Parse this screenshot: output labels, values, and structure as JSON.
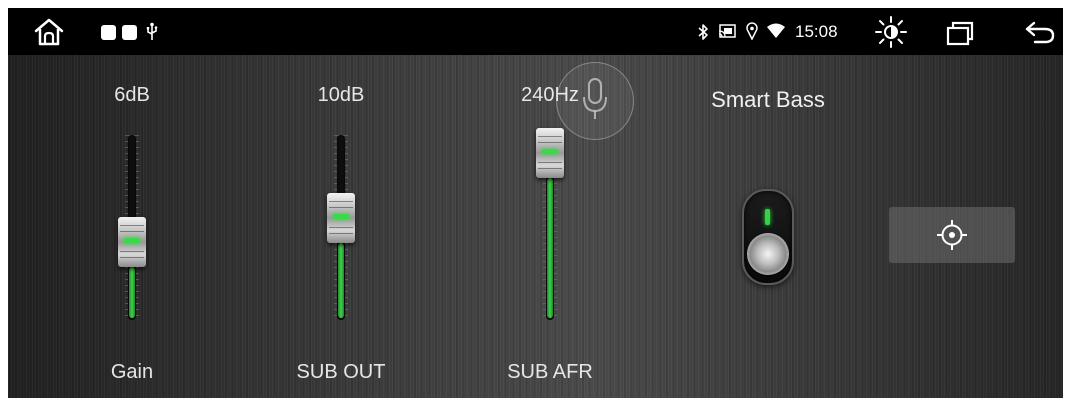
{
  "status_bar": {
    "home_icon": "home-icon",
    "notification_icons": [
      "app-square-icon",
      "app-square-icon",
      "usb-icon"
    ],
    "system_icons": [
      "bluetooth-icon",
      "cast-icon",
      "location-icon",
      "wifi-icon"
    ],
    "time": "15:08",
    "brightness_icon": "brightness-icon",
    "recents_icon": "recents-icon",
    "back_icon": "back-icon"
  },
  "sliders": [
    {
      "name": "gain",
      "label": "Gain",
      "value_text": "6dB",
      "level": 0.32
    },
    {
      "name": "sub-out",
      "label": "SUB OUT",
      "value_text": "10dB",
      "level": 0.5
    },
    {
      "name": "sub-afr",
      "label": "SUB AFR",
      "value_text": "240Hz",
      "level": 0.98
    }
  ],
  "smart_bass": {
    "label": "Smart Bass",
    "enabled": true
  },
  "reset_button": {
    "icon": "crosshair-icon"
  },
  "voice_overlay": {
    "icon": "microphone-icon"
  },
  "colors": {
    "accent_green": "#39d94a",
    "status_bar_bg": "#000000"
  }
}
